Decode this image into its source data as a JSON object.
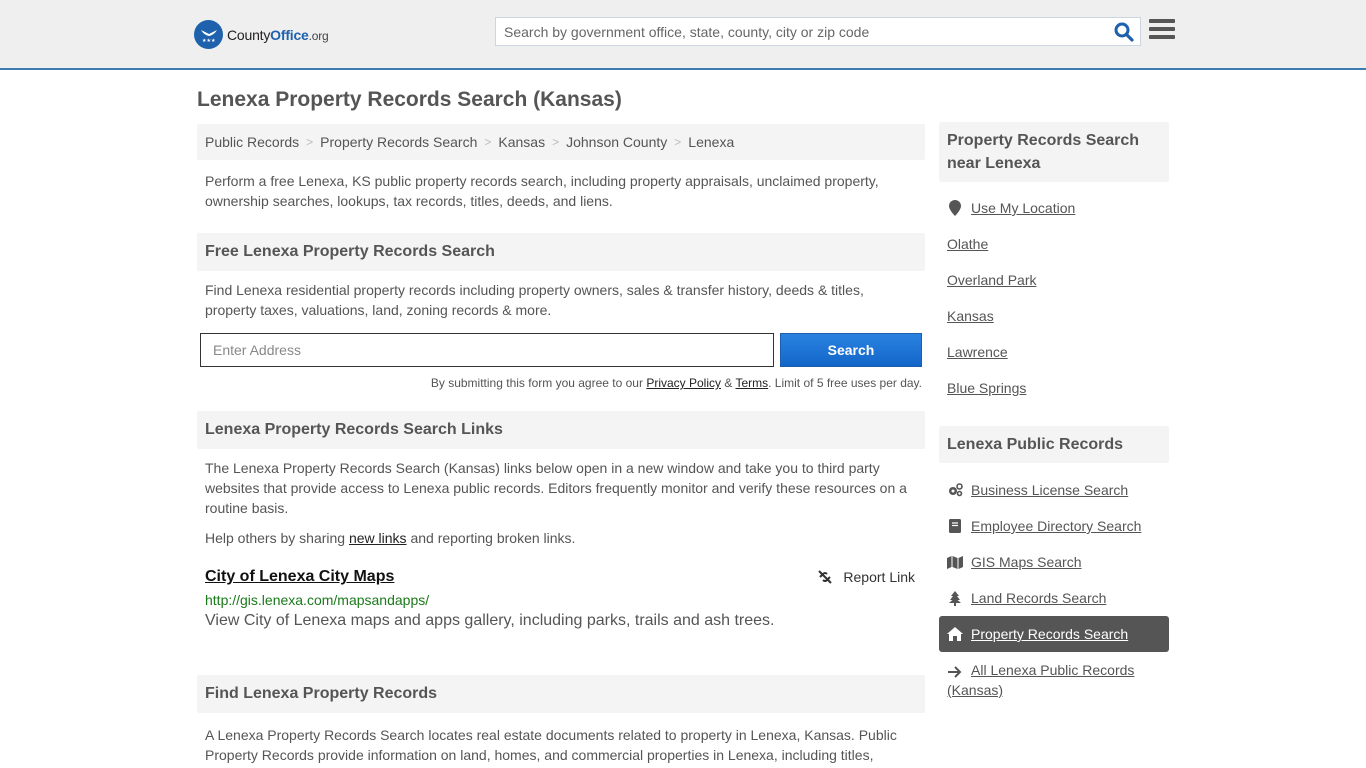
{
  "header": {
    "logo": {
      "name_part1": "County",
      "name_part2": "Office",
      "name_part3": ".org"
    },
    "search_placeholder": "Search by government office, state, county, city or zip code",
    "search_icon": "magnifier-icon",
    "menu_icon": "hamburger-icon",
    "accent_color": "#1e61ad"
  },
  "page": {
    "title": "Lenexa Property Records Search (Kansas)"
  },
  "breadcrumb": [
    {
      "label": "Public Records"
    },
    {
      "label": "Property Records Search"
    },
    {
      "label": "Kansas"
    },
    {
      "label": "Johnson County"
    },
    {
      "label": "Lenexa"
    }
  ],
  "intro": "Perform a free Lenexa, KS public property records search, including property appraisals, unclaimed property, ownership searches, lookups, tax records, titles, deeds, and liens.",
  "free_search": {
    "heading": "Free Lenexa Property Records Search",
    "description": "Find Lenexa residential property records including property owners, sales & transfer history, deeds & titles, property taxes, valuations, land, zoning records & more.",
    "input_placeholder": "Enter Address",
    "button_label": "Search",
    "button_color": "#1a6fd4",
    "disclaimer_prefix": "By submitting this form you agree to our ",
    "privacy_label": "Privacy Policy",
    "amp": " & ",
    "terms_label": "Terms",
    "disclaimer_suffix": ". Limit of 5 free uses per day."
  },
  "links_section": {
    "heading": "Lenexa Property Records Search Links",
    "description": "The Lenexa Property Records Search (Kansas) links below open in a new window and take you to third party websites that provide access to Lenexa public records. Editors frequently monitor and verify these resources on a routine basis.",
    "help_prefix": "Help others by sharing ",
    "help_link": "new links",
    "help_suffix": " and reporting broken links.",
    "items": [
      {
        "title": "City of Lenexa City Maps",
        "report_label": "Report Link",
        "url": "http://gis.lenexa.com/mapsandapps/",
        "description": "View City of Lenexa maps and apps gallery, including parks, trails and ash trees."
      }
    ]
  },
  "find_section": {
    "heading": "Find Lenexa Property Records",
    "description": "A Lenexa Property Records Search locates real estate documents related to property in Lenexa, Kansas. Public Property Records provide information on land, homes, and commercial properties in Lenexa, including titles,"
  },
  "sidebar": {
    "nearby": {
      "heading": "Property Records Search near Lenexa",
      "use_location": "Use My Location",
      "items": [
        "Olathe",
        "Overland Park",
        "Kansas",
        "Lawrence",
        "Blue Springs"
      ]
    },
    "public_records": {
      "heading": "Lenexa Public Records",
      "items": [
        {
          "label": "Business License Search",
          "icon": "gears-icon",
          "active": false
        },
        {
          "label": "Employee Directory Search",
          "icon": "book-icon",
          "active": false
        },
        {
          "label": "GIS Maps Search",
          "icon": "map-icon",
          "active": false
        },
        {
          "label": "Land Records Search",
          "icon": "tree-icon",
          "active": false
        },
        {
          "label": "Property Records Search",
          "icon": "home-icon",
          "active": true
        }
      ],
      "all_link": "All Lenexa Public Records (Kansas)"
    }
  }
}
